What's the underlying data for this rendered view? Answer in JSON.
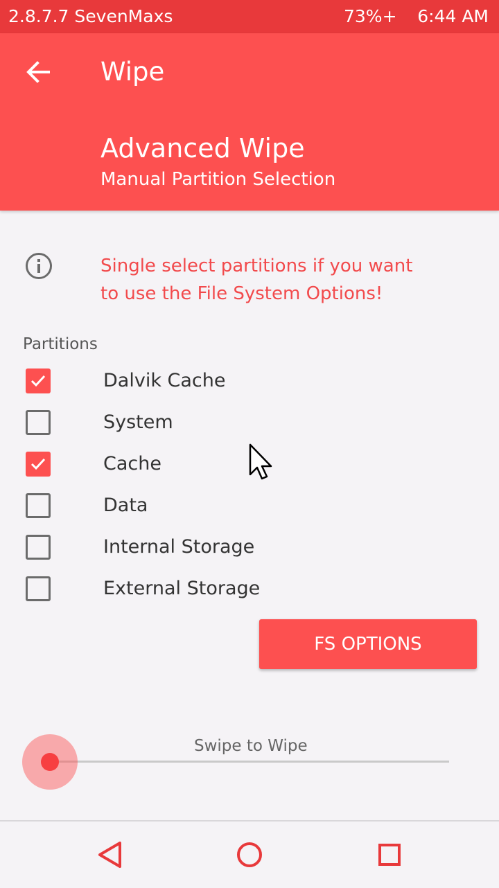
{
  "status_bar": {
    "title": "2.8.7.7 SevenMaxs",
    "battery": "73%+",
    "time": "6:44 AM"
  },
  "header": {
    "back_icon": "arrow-left-icon",
    "title": "Wipe",
    "heading": "Advanced Wipe",
    "subheading": "Manual Partition Selection"
  },
  "info": {
    "icon": "info-icon",
    "line1": "Single select partitions if you want",
    "line2": "to use the File System Options!"
  },
  "partitions": {
    "label": "Partitions",
    "items": [
      {
        "label": "Dalvik Cache",
        "checked": true
      },
      {
        "label": "System",
        "checked": false
      },
      {
        "label": "Cache",
        "checked": true
      },
      {
        "label": "Data",
        "checked": false
      },
      {
        "label": "Internal Storage",
        "checked": false
      },
      {
        "label": "External Storage",
        "checked": false
      }
    ]
  },
  "fs_button": {
    "label": "FS OPTIONS"
  },
  "swipe": {
    "label": "Swipe to Wipe",
    "progress": 0
  },
  "navbar": {
    "back_icon": "triangle-back-icon",
    "home_icon": "circle-home-icon",
    "recent_icon": "square-recent-icon"
  },
  "colors": {
    "status_bar": "#e8393b",
    "accent": "#fd5050",
    "warning_text": "#f24a4c",
    "background": "#f5f3f6"
  }
}
